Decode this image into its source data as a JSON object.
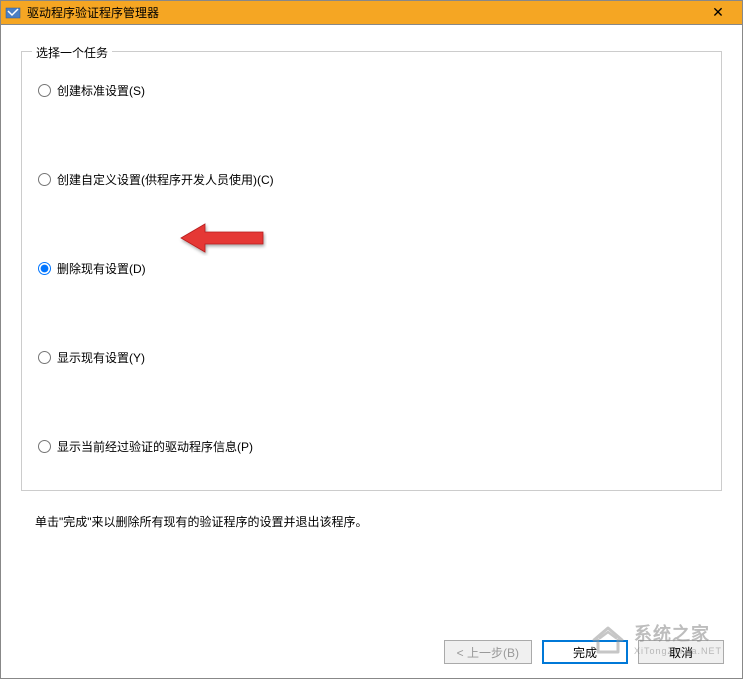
{
  "window": {
    "title": "驱动程序验证程序管理器"
  },
  "fieldset": {
    "legend": "选择一个任务"
  },
  "radios": {
    "option1": "创建标准设置(S)",
    "option2": "创建自定义设置(供程序开发人员使用)(C)",
    "option3": "删除现有设置(D)",
    "option4": "显示现有设置(Y)",
    "option5": "显示当前经过验证的驱动程序信息(P)"
  },
  "instruction": "单击\"完成\"来以删除所有现有的验证程序的设置并退出该程序。",
  "buttons": {
    "back": "< 上一步(B)",
    "finish": "完成",
    "cancel": "取消"
  },
  "watermark": {
    "main": "系统之家",
    "sub": "XiTongZhiJia.NET"
  }
}
